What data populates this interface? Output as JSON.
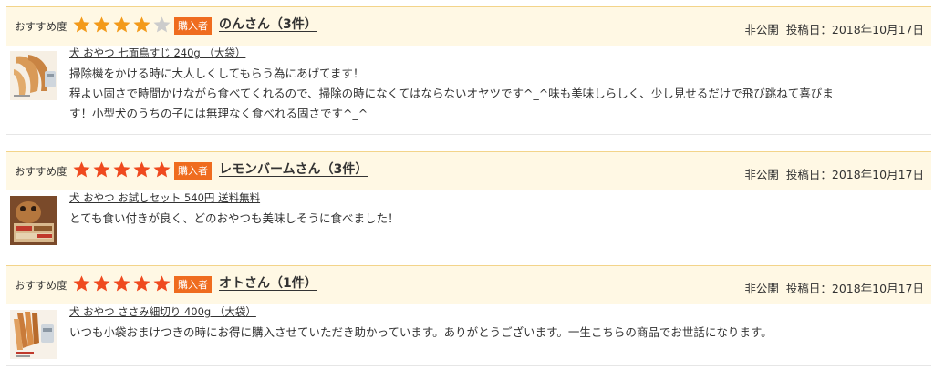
{
  "reviews": [
    {
      "rec_label": "おすすめ度",
      "rating": 4,
      "max_rating": 5,
      "badge": "購入者",
      "reviewer": "のんさん（3件）",
      "privacy": "非公開",
      "posted": "投稿日：2018年10月17日",
      "product": "犬 おやつ 七面鳥すじ 240g （大袋）",
      "comment_lines": [
        "掃除機をかける時に大人しくしてもらう為にあげてます！",
        "程よい固さで時間かけながら食べてくれるので、掃除の時になくてはならないオヤツです^_^味も美味しらしく、少し見せるだけで飛び跳ねて喜びま",
        "す！小型犬のうちの子には無理なく食べれる固さです^_^"
      ]
    },
    {
      "rec_label": "おすすめ度",
      "rating": 5,
      "max_rating": 5,
      "badge": "購入者",
      "reviewer": "レモンバームさん（3件）",
      "privacy": "非公開",
      "posted": "投稿日：2018年10月17日",
      "product": "犬 おやつ お試しセット 540円 送料無料",
      "comment_lines": [
        "とても食い付きが良く、どのおやつも美味しそうに食べました！"
      ]
    },
    {
      "rec_label": "おすすめ度",
      "rating": 5,
      "max_rating": 5,
      "badge": "購入者",
      "reviewer": "オトさん（1件）",
      "privacy": "非公開",
      "posted": "投稿日：2018年10月17日",
      "product": "犬 おやつ ささみ細切り 400g （大袋）",
      "comment_lines": [
        "いつも小袋おまけつきの時にお得に購入させていただき助かっています。ありがとうございます。一生こちらの商品でお世話になります。"
      ]
    }
  ],
  "colors": {
    "star_filled": "#ef4a1f",
    "star_partial": "#f39a1a",
    "star_empty": "#cccccc",
    "badge_bg": "#ef6c1f",
    "header_bg": "#fff8e4"
  }
}
